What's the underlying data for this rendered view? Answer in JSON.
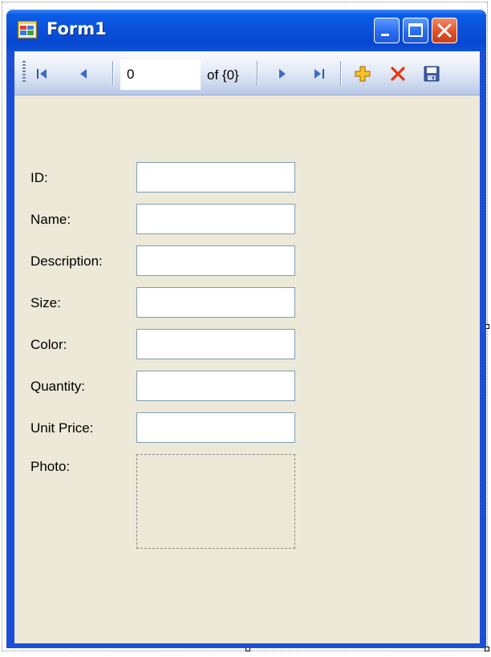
{
  "window": {
    "title": "Form1"
  },
  "navigator": {
    "position_value": "0",
    "count_label": "of {0}",
    "icons": [
      "move-first-icon",
      "move-previous-icon",
      "move-next-icon",
      "move-last-icon",
      "add-new-icon",
      "delete-icon",
      "save-icon"
    ]
  },
  "fields": {
    "id": {
      "label": "ID:",
      "value": ""
    },
    "name": {
      "label": "Name:",
      "value": ""
    },
    "description": {
      "label": "Description:",
      "value": ""
    },
    "size": {
      "label": "Size:",
      "value": ""
    },
    "color": {
      "label": "Color:",
      "value": ""
    },
    "quantity": {
      "label": "Quantity:",
      "value": ""
    },
    "unit_price": {
      "label": "Unit Price:",
      "value": ""
    },
    "photo": {
      "label": "Photo:"
    }
  },
  "colors": {
    "title_bar": "#0a4fd8",
    "client_bg": "#ece9d8",
    "close_button": "#e0502a",
    "delete_icon": "#e8340c",
    "add_icon": "#f4b400"
  }
}
